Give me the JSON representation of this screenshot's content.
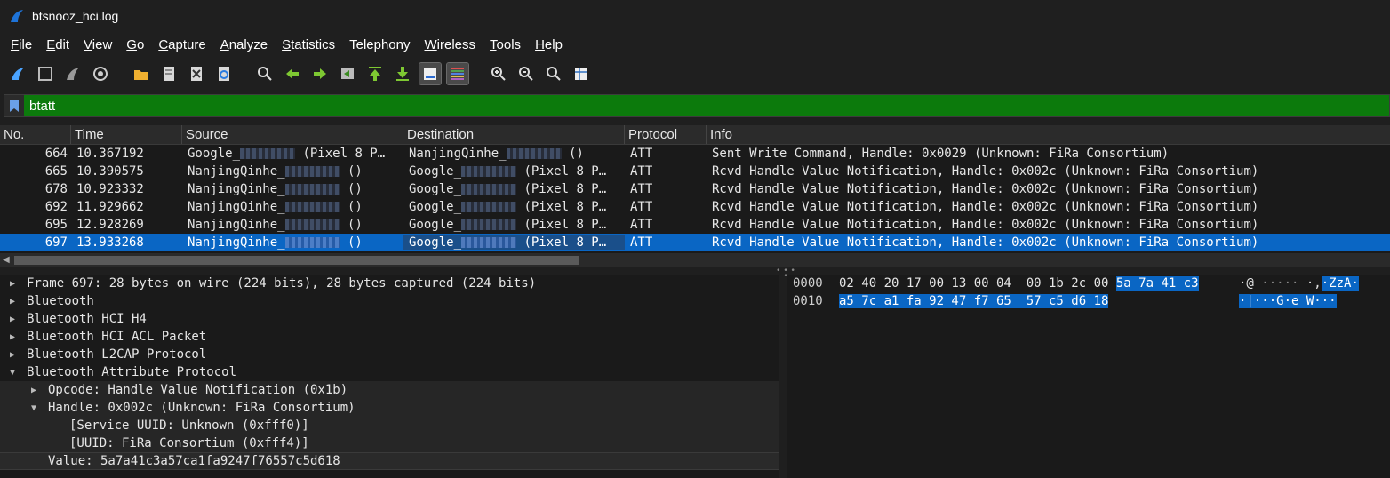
{
  "window": {
    "title": "btsnooz_hci.log"
  },
  "menu": [
    {
      "u": "F",
      "rest": "ile"
    },
    {
      "u": "E",
      "rest": "dit"
    },
    {
      "u": "V",
      "rest": "iew"
    },
    {
      "u": "G",
      "rest": "o"
    },
    {
      "u": "C",
      "rest": "apture"
    },
    {
      "u": "A",
      "rest": "nalyze"
    },
    {
      "u": "S",
      "rest": "tatistics"
    },
    {
      "u": "",
      "rest": "Telephony"
    },
    {
      "u": "W",
      "rest": "ireless"
    },
    {
      "u": "T",
      "rest": "ools"
    },
    {
      "u": "H",
      "rest": "elp"
    }
  ],
  "filter": {
    "value": "btatt"
  },
  "columns": {
    "no": "No.",
    "time": "Time",
    "source": "Source",
    "destination": "Destination",
    "protocol": "Protocol",
    "info": "Info"
  },
  "packets": [
    {
      "no": "664",
      "time": "10.367192",
      "src_pre": "Google_",
      "src_post": " (Pixel 8 P…",
      "dst_pre": "NanjingQinhe_",
      "dst_post": " ()",
      "proto": "ATT",
      "info": "Sent Write Command, Handle: 0x0029 (Unknown: FiRa Consortium)"
    },
    {
      "no": "665",
      "time": "10.390575",
      "src_pre": "NanjingQinhe_",
      "src_post": " ()",
      "dst_pre": "Google_",
      "dst_post": " (Pixel 8 P…",
      "proto": "ATT",
      "info": "Rcvd Handle Value Notification, Handle: 0x002c (Unknown: FiRa Consortium)"
    },
    {
      "no": "678",
      "time": "10.923332",
      "src_pre": "NanjingQinhe_",
      "src_post": " ()",
      "dst_pre": "Google_",
      "dst_post": " (Pixel 8 P…",
      "proto": "ATT",
      "info": "Rcvd Handle Value Notification, Handle: 0x002c (Unknown: FiRa Consortium)"
    },
    {
      "no": "692",
      "time": "11.929662",
      "src_pre": "NanjingQinhe_",
      "src_post": " ()",
      "dst_pre": "Google_",
      "dst_post": " (Pixel 8 P…",
      "proto": "ATT",
      "info": "Rcvd Handle Value Notification, Handle: 0x002c (Unknown: FiRa Consortium)"
    },
    {
      "no": "695",
      "time": "12.928269",
      "src_pre": "NanjingQinhe_",
      "src_post": " ()",
      "dst_pre": "Google_",
      "dst_post": " (Pixel 8 P…",
      "proto": "ATT",
      "info": "Rcvd Handle Value Notification, Handle: 0x002c (Unknown: FiRa Consortium)"
    },
    {
      "no": "697",
      "time": "13.933268",
      "src_pre": "NanjingQinhe_",
      "src_post": " ()",
      "dst_pre": "Google_",
      "dst_post": " (Pixel 8 P…",
      "proto": "ATT",
      "info": "Rcvd Handle Value Notification, Handle: 0x002c (Unknown: FiRa Consortium)"
    }
  ],
  "tree": [
    {
      "indent": 0,
      "expanded": false,
      "text": "Frame 697: 28 bytes on wire (224 bits), 28 bytes captured (224 bits)"
    },
    {
      "indent": 0,
      "expanded": false,
      "text": "Bluetooth"
    },
    {
      "indent": 0,
      "expanded": false,
      "text": "Bluetooth HCI H4"
    },
    {
      "indent": 0,
      "expanded": false,
      "text": "Bluetooth HCI ACL Packet"
    },
    {
      "indent": 0,
      "expanded": false,
      "text": "Bluetooth L2CAP Protocol"
    },
    {
      "indent": 0,
      "expanded": true,
      "text": "Bluetooth Attribute Protocol"
    },
    {
      "indent": 1,
      "expanded": false,
      "text": "Opcode: Handle Value Notification (0x1b)"
    },
    {
      "indent": 1,
      "expanded": true,
      "text": "Handle: 0x002c (Unknown: FiRa Consortium)"
    },
    {
      "indent": 2,
      "leaf": true,
      "text": "[Service UUID: Unknown (0xfff0)]"
    },
    {
      "indent": 2,
      "leaf": true,
      "text": "[UUID: FiRa Consortium (0xfff4)]"
    },
    {
      "indent": 1,
      "leaf": true,
      "text": "Value: 5a7a41c3a57ca1fa9247f76557c5d618"
    }
  ],
  "bytes": {
    "line1": {
      "offset": "0000",
      "hex_plain": "02 40 20 17 00 13 00 04  00 1b 2c 00 ",
      "hex_hl": "5a 7a 41 c3",
      "ascii_plain_a": "·@",
      "ascii_plain_dim": " ·····",
      "ascii_plain_b": " ·,",
      "ascii_hl": "·ZzA·"
    },
    "line2": {
      "offset": "0010",
      "hex_hl": "a5 7c a1 fa 92 47 f7 65  57 c5 d6 18",
      "ascii_hl": "·|···G·e W···"
    }
  }
}
